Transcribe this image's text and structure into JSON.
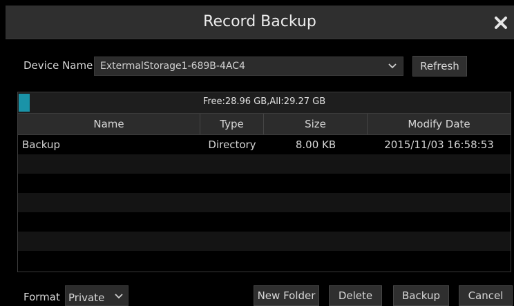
{
  "dialog": {
    "title": "Record Backup",
    "close_icon": "close-icon"
  },
  "device": {
    "label": "Device Name",
    "selected": "ExtermalStorage1-689B-4AC4",
    "refresh_label": "Refresh"
  },
  "storage": {
    "text": "Free:28.96 GB,All:29.27 GB",
    "used_fraction": 0.011,
    "fill_color": "#1a93a8"
  },
  "table": {
    "columns": [
      "Name",
      "Type",
      "Size",
      "Modify Date"
    ],
    "rows": [
      {
        "name": "Backup",
        "type": "Directory",
        "size": "8.00 KB",
        "date": "2015/11/03 16:58:53"
      }
    ]
  },
  "footer": {
    "format_label": "Format",
    "format_value": "Private",
    "new_folder_label": "New Folder",
    "delete_label": "Delete",
    "backup_label": "Backup",
    "cancel_label": "Cancel"
  }
}
